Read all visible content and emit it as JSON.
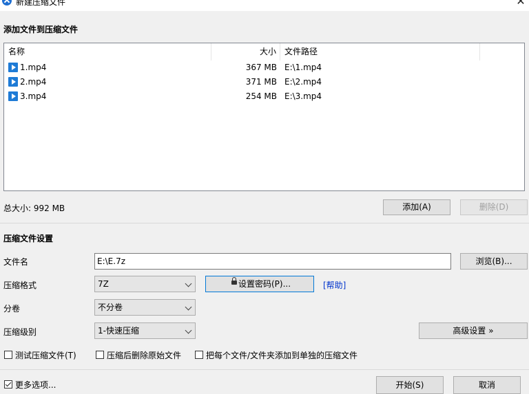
{
  "window": {
    "title": "新建压缩文件",
    "close_glyph": "✕"
  },
  "add_section": {
    "title": "添加文件到压缩文件"
  },
  "file_list": {
    "columns": [
      "名称",
      "大小",
      "文件路径"
    ],
    "rows": [
      {
        "name": "1.mp4",
        "size": "367 MB",
        "path": "E:\\1.mp4"
      },
      {
        "name": "2.mp4",
        "size": "371 MB",
        "path": "E:\\2.mp4"
      },
      {
        "name": "3.mp4",
        "size": "254 MB",
        "path": "E:\\3.mp4"
      }
    ]
  },
  "total_size": "总大小: 992 MB",
  "buttons": {
    "add": "添加(A)",
    "delete": "删除(D)",
    "browse": "浏览(B)...",
    "set_password": "设置密码(P)...",
    "help": "[帮助]",
    "advanced": "高级设置 »",
    "start": "开始(S)",
    "cancel": "取消"
  },
  "settings": {
    "title": "压缩文件设置",
    "filename_label": "文件名",
    "filename_value": "E:\\E.7z",
    "format_label": "压缩格式",
    "format_value": "7Z",
    "volume_label": "分卷",
    "volume_value": "不分卷",
    "level_label": "压缩级别",
    "level_value": "1-快速压缩"
  },
  "options": {
    "test": {
      "label": "测试压缩文件(T)",
      "checked": false
    },
    "delete_after": {
      "label": "压缩后删除原始文件",
      "checked": false
    },
    "separate": {
      "label": "把每个文件/文件夹添加到单独的压缩文件",
      "checked": false
    },
    "more": {
      "label": "更多选项...",
      "checked": true
    }
  },
  "colors": {
    "accent": "#0078d7",
    "file_icon": "#1e7bd6",
    "link": "#0033cc"
  }
}
